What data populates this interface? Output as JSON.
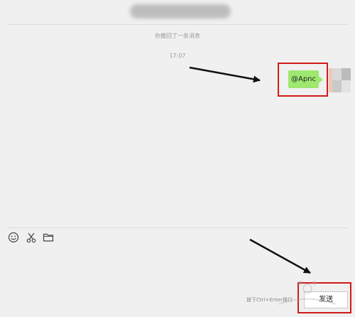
{
  "chat": {
    "recall_notice": "你撤回了一条消息",
    "timestamp": "17:07",
    "message_text": "@Apnc"
  },
  "toolbar": {
    "icons": [
      "emoji-icon",
      "scissors-icon",
      "folder-icon"
    ]
  },
  "footer": {
    "hint": "按下Ctrl+Enter换行",
    "send_label": "发送"
  },
  "colors": {
    "background": "#f0f0f0",
    "bubble": "#9ee870",
    "highlight": "#d11a1a"
  }
}
